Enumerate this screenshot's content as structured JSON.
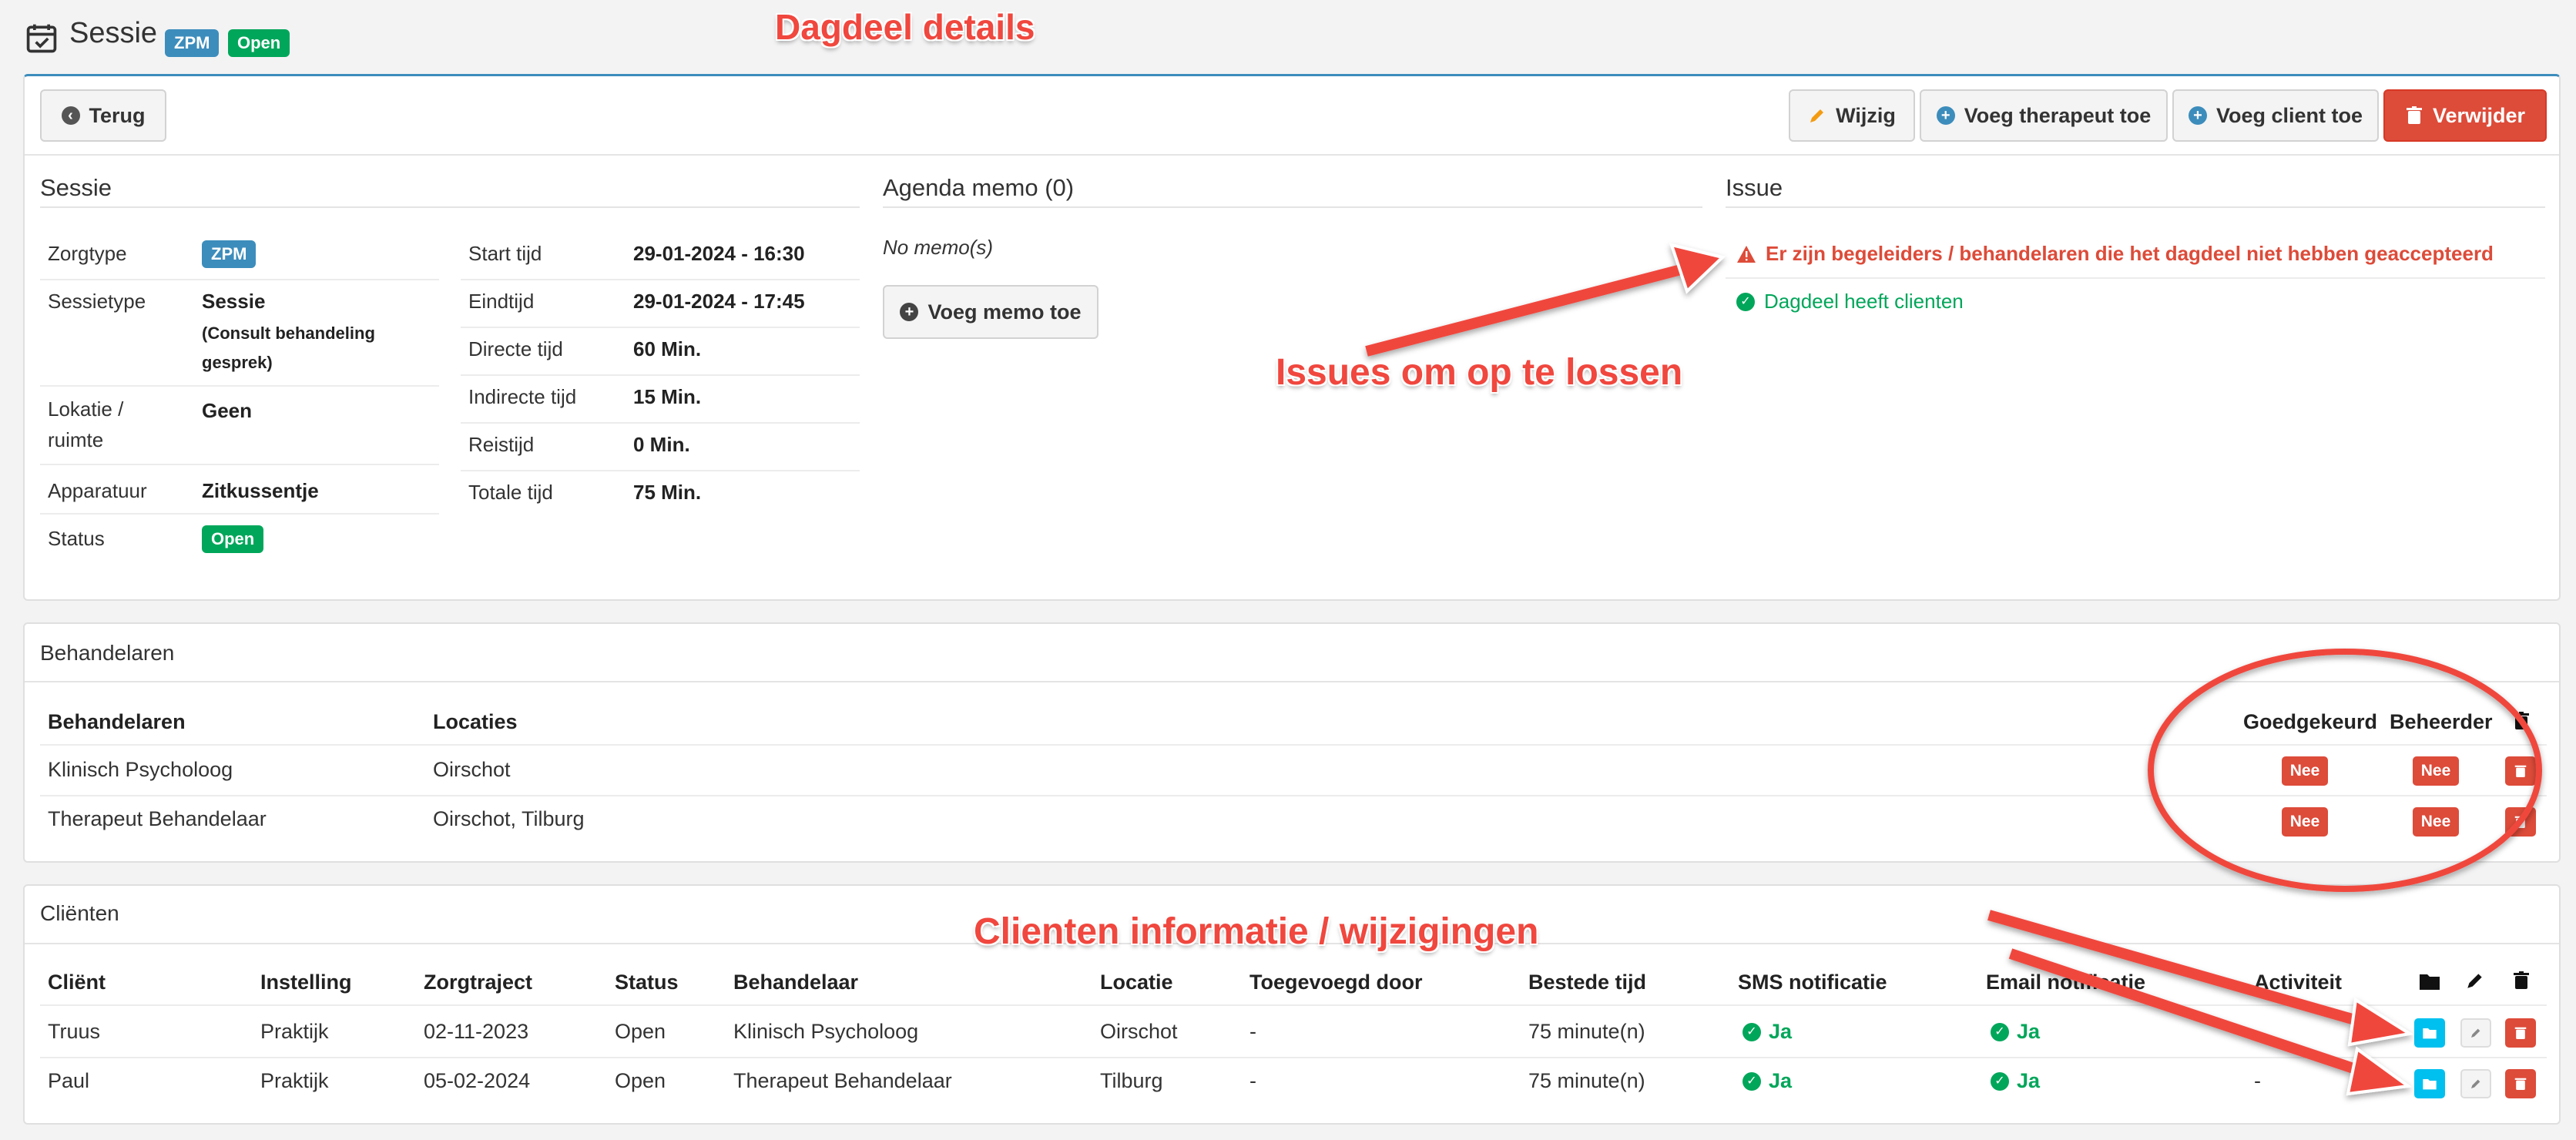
{
  "header": {
    "title": "Sessie",
    "badge_zpm": "ZPM",
    "badge_status": "Open"
  },
  "annotations": {
    "title": "Dagdeel details",
    "issues": "Issues om op te lossen",
    "clients": "Clienten informatie / wijzigingen"
  },
  "toolbar": {
    "back": "Terug",
    "edit": "Wijzig",
    "add_therapist": "Voeg therapeut toe",
    "add_client": "Voeg client toe",
    "delete": "Verwijder"
  },
  "session": {
    "heading": "Sessie",
    "left": [
      {
        "label": "Zorgtype",
        "badge": "ZPM"
      },
      {
        "label": "Sessietype",
        "value": "Sessie",
        "sub1": "(Consult behandeling",
        "sub2": "gesprek)"
      },
      {
        "label1": "Lokatie /",
        "label2": "ruimte",
        "value": "Geen"
      },
      {
        "label": "Apparatuur",
        "value": "Zitkussentje"
      },
      {
        "label": "Status",
        "badge": "Open"
      }
    ],
    "right": [
      {
        "label": "Start tijd",
        "value": "29-01-2024 - 16:30"
      },
      {
        "label": "Eindtijd",
        "value": "29-01-2024 - 17:45"
      },
      {
        "label": "Directe tijd",
        "value": "60 Min."
      },
      {
        "label": "Indirecte tijd",
        "value": "15 Min."
      },
      {
        "label": "Reistijd",
        "value": "0 Min."
      },
      {
        "label": "Totale tijd",
        "value": "75 Min."
      }
    ]
  },
  "memo": {
    "heading": "Agenda memo (0)",
    "empty": "No memo(s)",
    "add": "Voeg memo toe"
  },
  "issue": {
    "heading": "Issue",
    "items": [
      {
        "text": "Er zijn begeleiders / behandelaren die het dagdeel niet hebben geaccepteerd",
        "color": "#dd4b39"
      },
      {
        "text": "Dagdeel heeft clienten",
        "color": "#00a65a"
      }
    ]
  },
  "therapists": {
    "heading": "Behandelaren",
    "columns": [
      "Behandelaren",
      "Locaties",
      "Goedgekeurd",
      "Beheerder"
    ],
    "rows": [
      {
        "name": "Klinisch Psycholoog",
        "locations": "Oirschot",
        "approved": "Nee",
        "admin": "Nee"
      },
      {
        "name": "Therapeut Behandelaar",
        "locations": "Oirschot, Tilburg",
        "approved": "Nee",
        "admin": "Nee"
      }
    ]
  },
  "clients": {
    "heading": "Cliënten",
    "columns": [
      "Cliënt",
      "Instelling",
      "Zorgtraject",
      "Status",
      "Behandelaar",
      "Locatie",
      "Toegevoegd door",
      "Bestede tijd",
      "SMS notificatie",
      "Email notificatie",
      "Activiteit"
    ],
    "rows": [
      {
        "client": "Truus",
        "institution": "Praktijk",
        "trajectory": "02-11-2023",
        "status": "Open",
        "therapist": "Klinisch Psycholoog",
        "location": "Oirschot",
        "added_by": "-",
        "time": "75 minute(n)",
        "sms": "Ja",
        "email": "Ja",
        "activity": ""
      },
      {
        "client": "Paul",
        "institution": "Praktijk",
        "trajectory": "05-02-2024",
        "status": "Open",
        "therapist": "Therapeut Behandelaar",
        "location": "Tilburg",
        "added_by": "-",
        "time": "75 minute(n)",
        "sms": "Ja",
        "email": "Ja",
        "activity": "-"
      }
    ]
  },
  "colors": {
    "primary": "#3c8dbc",
    "success": "#00a65a",
    "danger": "#dd4b39",
    "info": "#00c0ef"
  }
}
